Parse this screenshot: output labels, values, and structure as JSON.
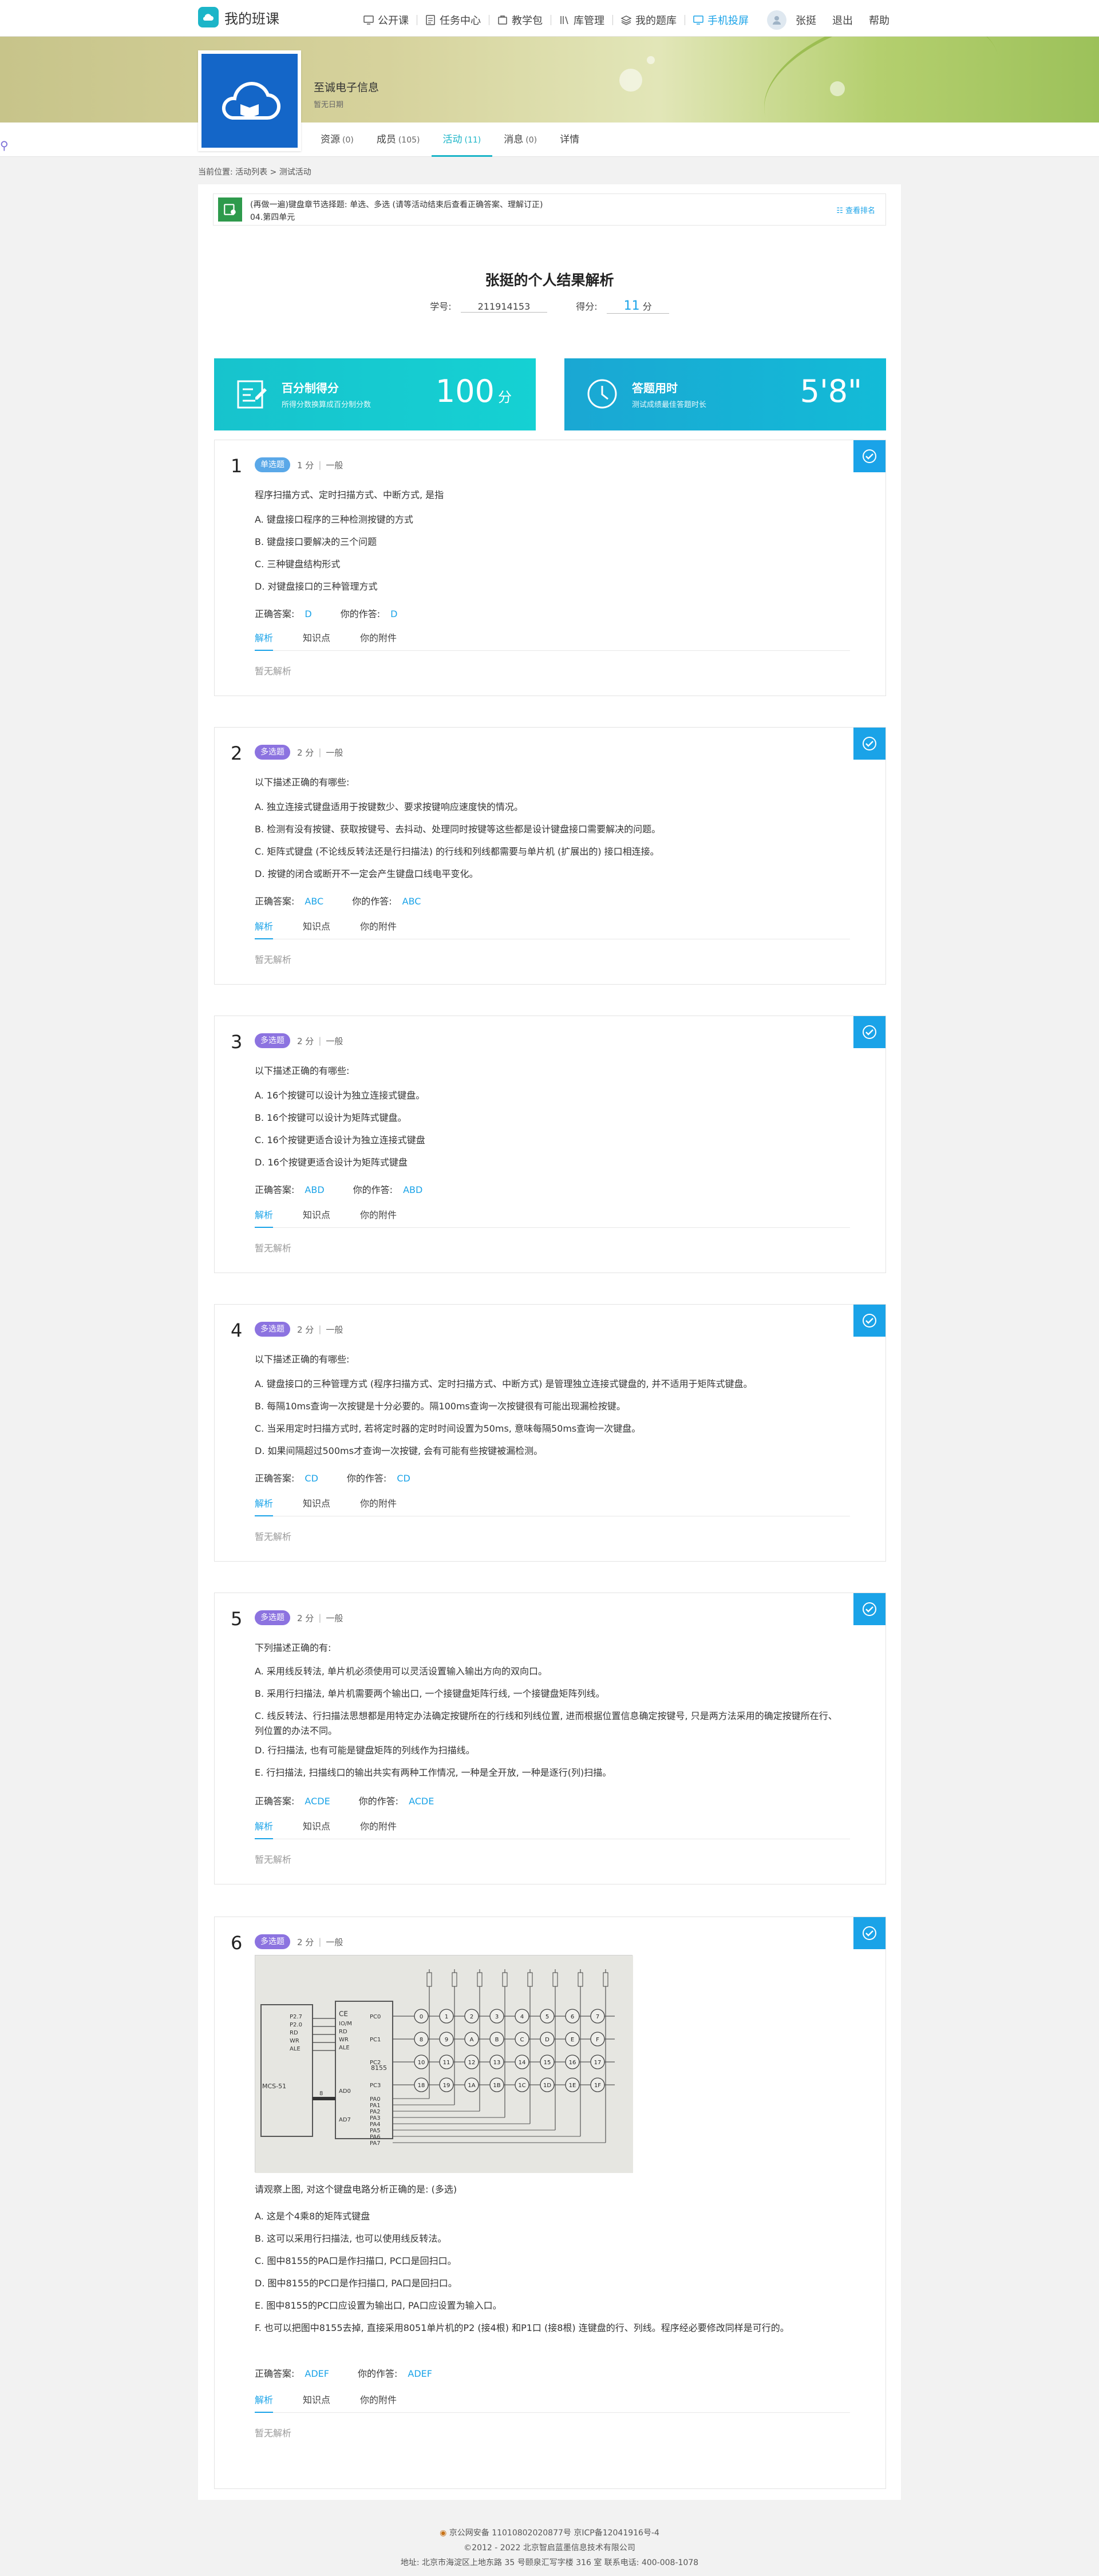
{
  "brand": {
    "title": "我的班课"
  },
  "nav": {
    "items": [
      {
        "label": "公开课",
        "icon": "monitor-icon"
      },
      {
        "label": "任务中心",
        "icon": "tasks-icon"
      },
      {
        "label": "教学包",
        "icon": "package-icon"
      },
      {
        "label": "库管理",
        "icon": "library-icon"
      },
      {
        "label": "我的题库",
        "icon": "stack-icon"
      },
      {
        "label": "手机投屏",
        "icon": "screen-cast-icon"
      }
    ],
    "user": "张挺",
    "logout": "退出",
    "help": "帮助"
  },
  "class": {
    "name": "至诚电子信息",
    "subtitle": "暂无日期"
  },
  "tabs": [
    {
      "label": "资源",
      "count": "(0)"
    },
    {
      "label": "成员",
      "count": "(105)"
    },
    {
      "label": "活动",
      "count": "(11)"
    },
    {
      "label": "消息",
      "count": "(0)"
    },
    {
      "label": "详情",
      "count": ""
    }
  ],
  "breadcrumb": "当前位置: 活动列表 > 测试活动",
  "activity": {
    "line1": "(再做一遍)键盘章节选择题: 单选、多选 (请等活动结束后查看正确答案、理解订正)",
    "line2": "04.第四单元",
    "right_link": "查看排名"
  },
  "result": {
    "title": "张挺的个人结果解析",
    "id_label": "学号:",
    "id_value": "211914153",
    "score_label": "得分:",
    "score_value": "11",
    "score_unit": "分"
  },
  "stats": [
    {
      "label": "百分制得分",
      "sub": "所得分数换算成百分制分数",
      "value": "100",
      "unit": "分"
    },
    {
      "label": "答题用时",
      "sub": "测试成绩最佳答题时长",
      "value": "5'8\"",
      "unit": ""
    }
  ],
  "labels": {
    "correct": "正确答案:",
    "yours": "你的作答:",
    "tab_analysis": "解析",
    "tab_knowledge": "知识点",
    "tab_attachment": "你的附件",
    "no_analysis": "暂无解析"
  },
  "questions": [
    {
      "num": "1",
      "type": "单选题",
      "score": "1 分",
      "level": "一般",
      "stem": "程序扫描方式、定时扫描方式、中断方式, 是指",
      "options": [
        "A. 键盘接口程序的三种检测按键的方式",
        "B. 键盘接口要解决的三个问题",
        "C. 三种键盘结构形式",
        "D. 对键盘接口的三种管理方式"
      ],
      "correct": "D",
      "yours": "D"
    },
    {
      "num": "2",
      "type": "多选题",
      "score": "2 分",
      "level": "一般",
      "stem": "以下描述正确的有哪些:",
      "options": [
        "A. 独立连接式键盘适用于按键数少、要求按键响应速度快的情况。",
        "B. 检测有没有按键、获取按键号、去抖动、处理同时按键等这些都是设计键盘接口需要解决的问题。",
        "C. 矩阵式键盘 (不论线反转法还是行扫描法) 的行线和列线都需要与单片机 (扩展出的) 接口相连接。",
        "D. 按键的闭合或断开不一定会产生键盘口线电平变化。"
      ],
      "correct": "ABC",
      "yours": "ABC"
    },
    {
      "num": "3",
      "type": "多选题",
      "score": "2 分",
      "level": "一般",
      "stem": "以下描述正确的有哪些:",
      "options": [
        "A. 16个按键可以设计为独立连接式键盘。",
        "B. 16个按键可以设计为矩阵式键盘。",
        "C. 16个按键更适合设计为独立连接式键盘",
        "D. 16个按键更适合设计为矩阵式键盘"
      ],
      "correct": "ABD",
      "yours": "ABD"
    },
    {
      "num": "4",
      "type": "多选题",
      "score": "2 分",
      "level": "一般",
      "stem": "以下描述正确的有哪些:",
      "options": [
        "A. 键盘接口的三种管理方式 (程序扫描方式、定时扫描方式、中断方式) 是管理独立连接式键盘的, 并不适用于矩阵式键盘。",
        "B. 每隔10ms查询一次按键是十分必要的。隔100ms查询一次按键很有可能出现漏检按键。",
        "C. 当采用定时扫描方式时, 若将定时器的定时时间设置为50ms, 意味每隔50ms查询一次键盘。",
        "D. 如果间隔超过500ms才查询一次按键, 会有可能有些按键被漏检测。"
      ],
      "correct": "CD",
      "yours": "CD"
    },
    {
      "num": "5",
      "type": "多选题",
      "score": "2 分",
      "level": "一般",
      "stem": "下列描述正确的有:",
      "options": [
        "A. 采用线反转法, 单片机必须使用可以灵活设置输入输出方向的双向口。",
        "B. 采用行扫描法, 单片机需要两个输出口, 一个接键盘矩阵行线, 一个接键盘矩阵列线。",
        "C. 线反转法、行扫描法思想都是用特定办法确定按键所在的行线和列线位置, 进而根据位置信息确定按键号, 只是两方法采用的确定按键所在行、列位置的办法不同。",
        "D. 行扫描法, 也有可能是键盘矩阵的列线作为扫描线。",
        "E. 行扫描法, 扫描线口的输出共实有两种工作情况, 一种是全开放, 一种是逐行(列)扫描。"
      ],
      "correct": "ACDE",
      "yours": "ACDE"
    },
    {
      "num": "6",
      "type": "多选题",
      "score": "2 分",
      "level": "一般",
      "stem": "请观察上图, 对这个键盘电路分析正确的是: (多选)",
      "options": [
        "A. 这是个4乘8的矩阵式键盘",
        "B. 这可以采用行扫描法, 也可以使用线反转法。",
        "C. 图中8155的PA口是作扫描口, PC口是回扫口。",
        "D. 图中8155的PC口是作扫描口, PA口是回扫口。",
        "E. 图中8155的PC口应设置为输出口, PA口应设置为输入口。",
        "F. 也可以把图中8155去掉, 直接采用8051单片机的P2 (接4根) 和P1口 (接8根) 连键盘的行、列线。程序经必要修改同样是可行的。"
      ],
      "correct": "ADEF",
      "yours": "ADEF",
      "figure": {
        "chip_left": "MCS-51",
        "chip_right": "8155",
        "left_pins": [
          "P2.7",
          "P2.0",
          "RD",
          "WR",
          "ALE"
        ],
        "right_pins": [
          "CE",
          "IO/M",
          "RD",
          "WR",
          "ALE",
          "AD0",
          "AD7"
        ],
        "port_labels": [
          "PC0",
          "PC1",
          "PC2",
          "PC3",
          "PA0",
          "PA1",
          "PA2",
          "PA3",
          "PA4",
          "PA5",
          "PA6",
          "PA7"
        ],
        "key_labels": [
          [
            "0",
            "1",
            "2",
            "3",
            "4",
            "5",
            "6",
            "7"
          ],
          [
            "8",
            "9",
            "A",
            "B",
            "C",
            "D",
            "E",
            "F"
          ],
          [
            "10",
            "11",
            "12",
            "13",
            "14",
            "15",
            "16",
            "17"
          ],
          [
            "18",
            "19",
            "1A",
            "1B",
            "1C",
            "1D",
            "1E",
            "1F"
          ]
        ],
        "bus_label": "8"
      }
    }
  ],
  "footer": {
    "line1": "京公网安备 11010802020877号   京ICP备12041916号-4",
    "line2": "©2012 - 2022 北京智启蓝墨信息技术有限公司",
    "line3": "地址: 北京市海淀区上地东路 35 号颐泉汇写字楼 316 室   联系电话: 400-008-1078"
  }
}
